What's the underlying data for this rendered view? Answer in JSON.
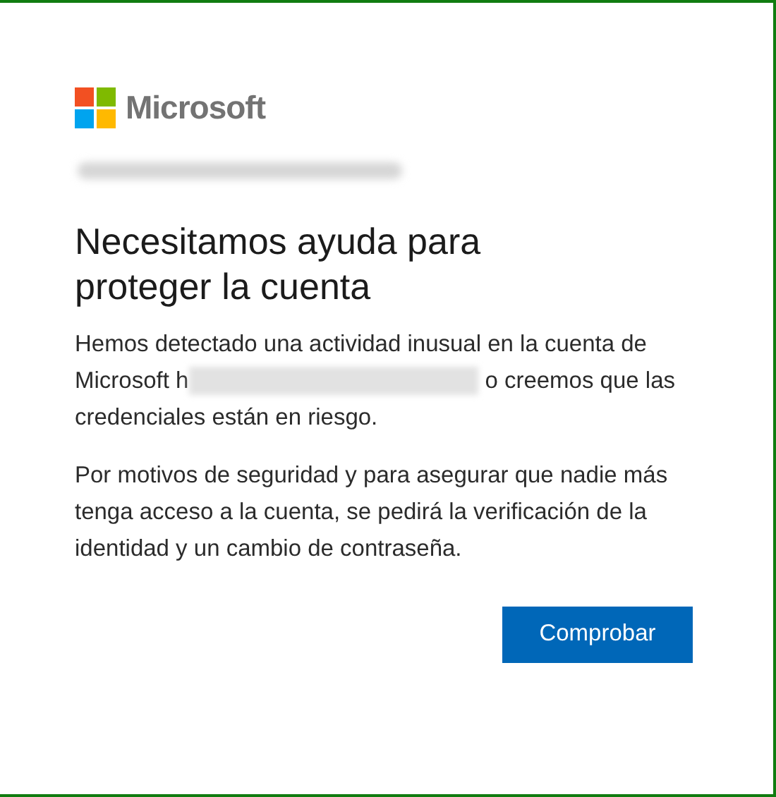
{
  "brand": {
    "name": "Microsoft"
  },
  "account_email": {
    "redacted": true
  },
  "title": "Necesitamos ayuda para proteger la cuenta",
  "paragraphs": [
    {
      "text_before": "Hemos detectado una actividad inusual en la cuenta de Microsoft h",
      "redacted": true,
      "text_after": "o creemos que las credenciales están en riesgo."
    },
    {
      "text_before": "Por motivos de seguridad y para asegurar que nadie más tenga acceso a la cuenta, se pedirá la verificación de la identidad y un cambio de contraseña.",
      "redacted": false
    }
  ],
  "button": {
    "label": "Comprobar"
  }
}
